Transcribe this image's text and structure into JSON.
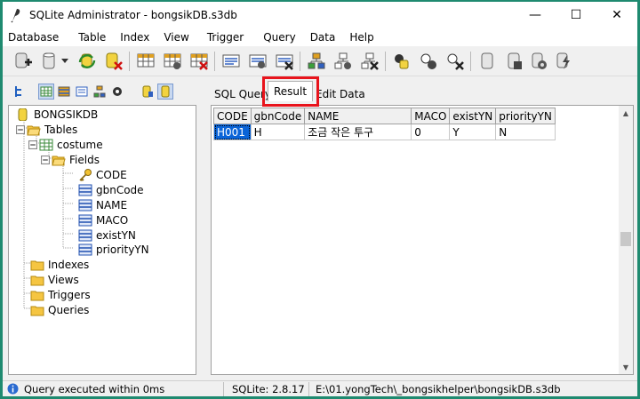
{
  "window": {
    "title": "SQLite Administrator - bongsikDB.s3db",
    "minimize": "—",
    "maximize": "☐",
    "close": "✕"
  },
  "menu": [
    "Database",
    "Table",
    "Index",
    "View",
    "Trigger",
    "Query",
    "Data",
    "Help"
  ],
  "tree": {
    "root": "BONGSIKDB",
    "tables": "Tables",
    "table": "costume",
    "fields": "Fields",
    "field_list": [
      "CODE",
      "gbnCode",
      "NAME",
      "MACO",
      "existYN",
      "priorityYN"
    ],
    "indexes": "Indexes",
    "views": "Views",
    "triggers": "Triggers",
    "queries": "Queries"
  },
  "tabs": {
    "sql_query": "SQL Query",
    "result": "Result",
    "edit_data": "Edit Data"
  },
  "grid": {
    "columns": [
      "CODE",
      "gbnCode",
      "NAME",
      "MACO",
      "existYN",
      "priorityYN"
    ],
    "rows": [
      [
        "H001",
        "H",
        "조금 작은 투구",
        "0",
        "Y",
        "N"
      ]
    ]
  },
  "status": {
    "message": "Query executed within 0ms",
    "version": "SQLite: 2.8.17",
    "path": "E:\\01.yongTech\\_bongsikhelper\\bongsikDB.s3db"
  },
  "colors": {
    "highlight": "#e8141c",
    "selection": "#0a64d8",
    "folder": "#f5c542"
  }
}
